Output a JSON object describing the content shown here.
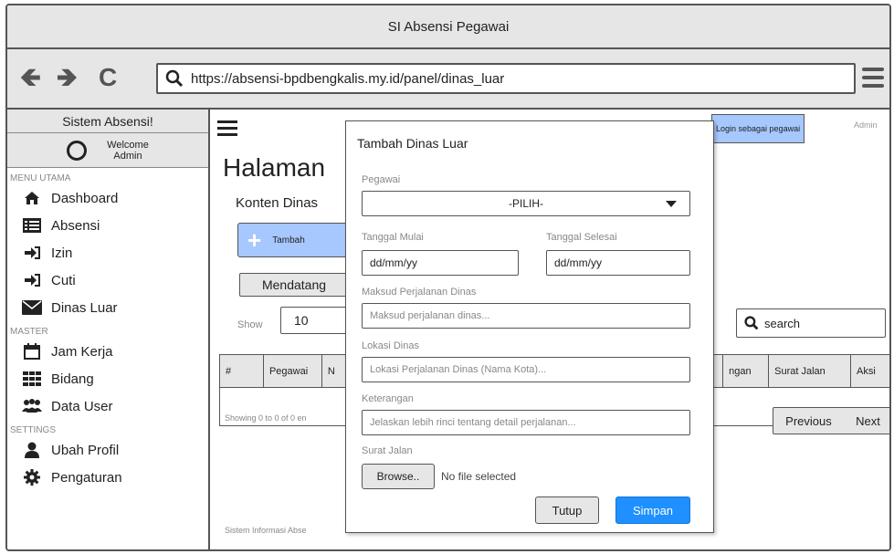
{
  "window": {
    "title": "SI Absensi Pegawai"
  },
  "browser": {
    "url": "https://absensi-bpdbengkalis.my.id/panel/dinas_luar"
  },
  "sidebar": {
    "title": "Sistem Absensi!",
    "welcome_line1": "Welcome",
    "welcome_line2": "Admin",
    "section_main": "MENU UTAMA",
    "section_master": "MASTER",
    "section_settings": "SETTINGS",
    "items": [
      {
        "label": "Dashboard",
        "icon": "home-icon"
      },
      {
        "label": "Absensi",
        "icon": "list-icon"
      },
      {
        "label": "Izin",
        "icon": "sign-in-icon"
      },
      {
        "label": "Cuti",
        "icon": "sign-in-icon"
      },
      {
        "label": "Dinas Luar",
        "icon": "envelope-icon"
      },
      {
        "label": "Jam Kerja",
        "icon": "calendar-icon"
      },
      {
        "label": "Bidang",
        "icon": "grid-icon"
      },
      {
        "label": "Data User",
        "icon": "users-icon"
      },
      {
        "label": "Ubah Profil",
        "icon": "user-icon"
      },
      {
        "label": "Pengaturan",
        "icon": "gear-icon"
      }
    ]
  },
  "header": {
    "login_badge": "Login sebagai pegawai",
    "admin_label": "Admin"
  },
  "main": {
    "heading": "Halaman",
    "subheading": "Konten Dinas",
    "tambah_label": "Tambah",
    "mendatang_label": "Mendatang",
    "show_label": "Show",
    "show_value": "10",
    "search_placeholder": "search",
    "table_headers": [
      "#",
      "Pegawai",
      "N",
      "ngan",
      "Surat Jalan",
      "Aksi"
    ],
    "showing_text": "Showing 0 to 0 of 0 en",
    "previous_label": "Previous",
    "next_label": "Next",
    "footer_text": "Sistem Informasi Abse"
  },
  "modal": {
    "title": "Tambah Dinas Luar",
    "pegawai_label": "Pegawai",
    "pegawai_value": "-PILIH-",
    "tgl_mulai_label": "Tanggal Mulai",
    "tgl_mulai_value": "dd/mm/yy",
    "tgl_selesai_label": "Tanggal Selesai",
    "tgl_selesai_value": "dd/mm/yy",
    "maksud_label": "Maksud Perjalanan Dinas",
    "maksud_placeholder": "Maksud perjalanan dinas...",
    "lokasi_label": "Lokasi Dinas",
    "lokasi_placeholder": "Lokasi Perjalanan Dinas (Nama Kota)...",
    "keterangan_label": "Keterangan",
    "keterangan_placeholder": "Jelaskan lebih rinci tentang detail perjalanan...",
    "surat_label": "Surat Jalan",
    "browse_label": "Browse..",
    "no_file_label": "No file selected",
    "tutup_label": "Tutup",
    "simpan_label": "Simpan"
  },
  "colors": {
    "accent": "#1e90ff",
    "badge": "#a6c8ff",
    "chrome": "#e6e6e6"
  }
}
